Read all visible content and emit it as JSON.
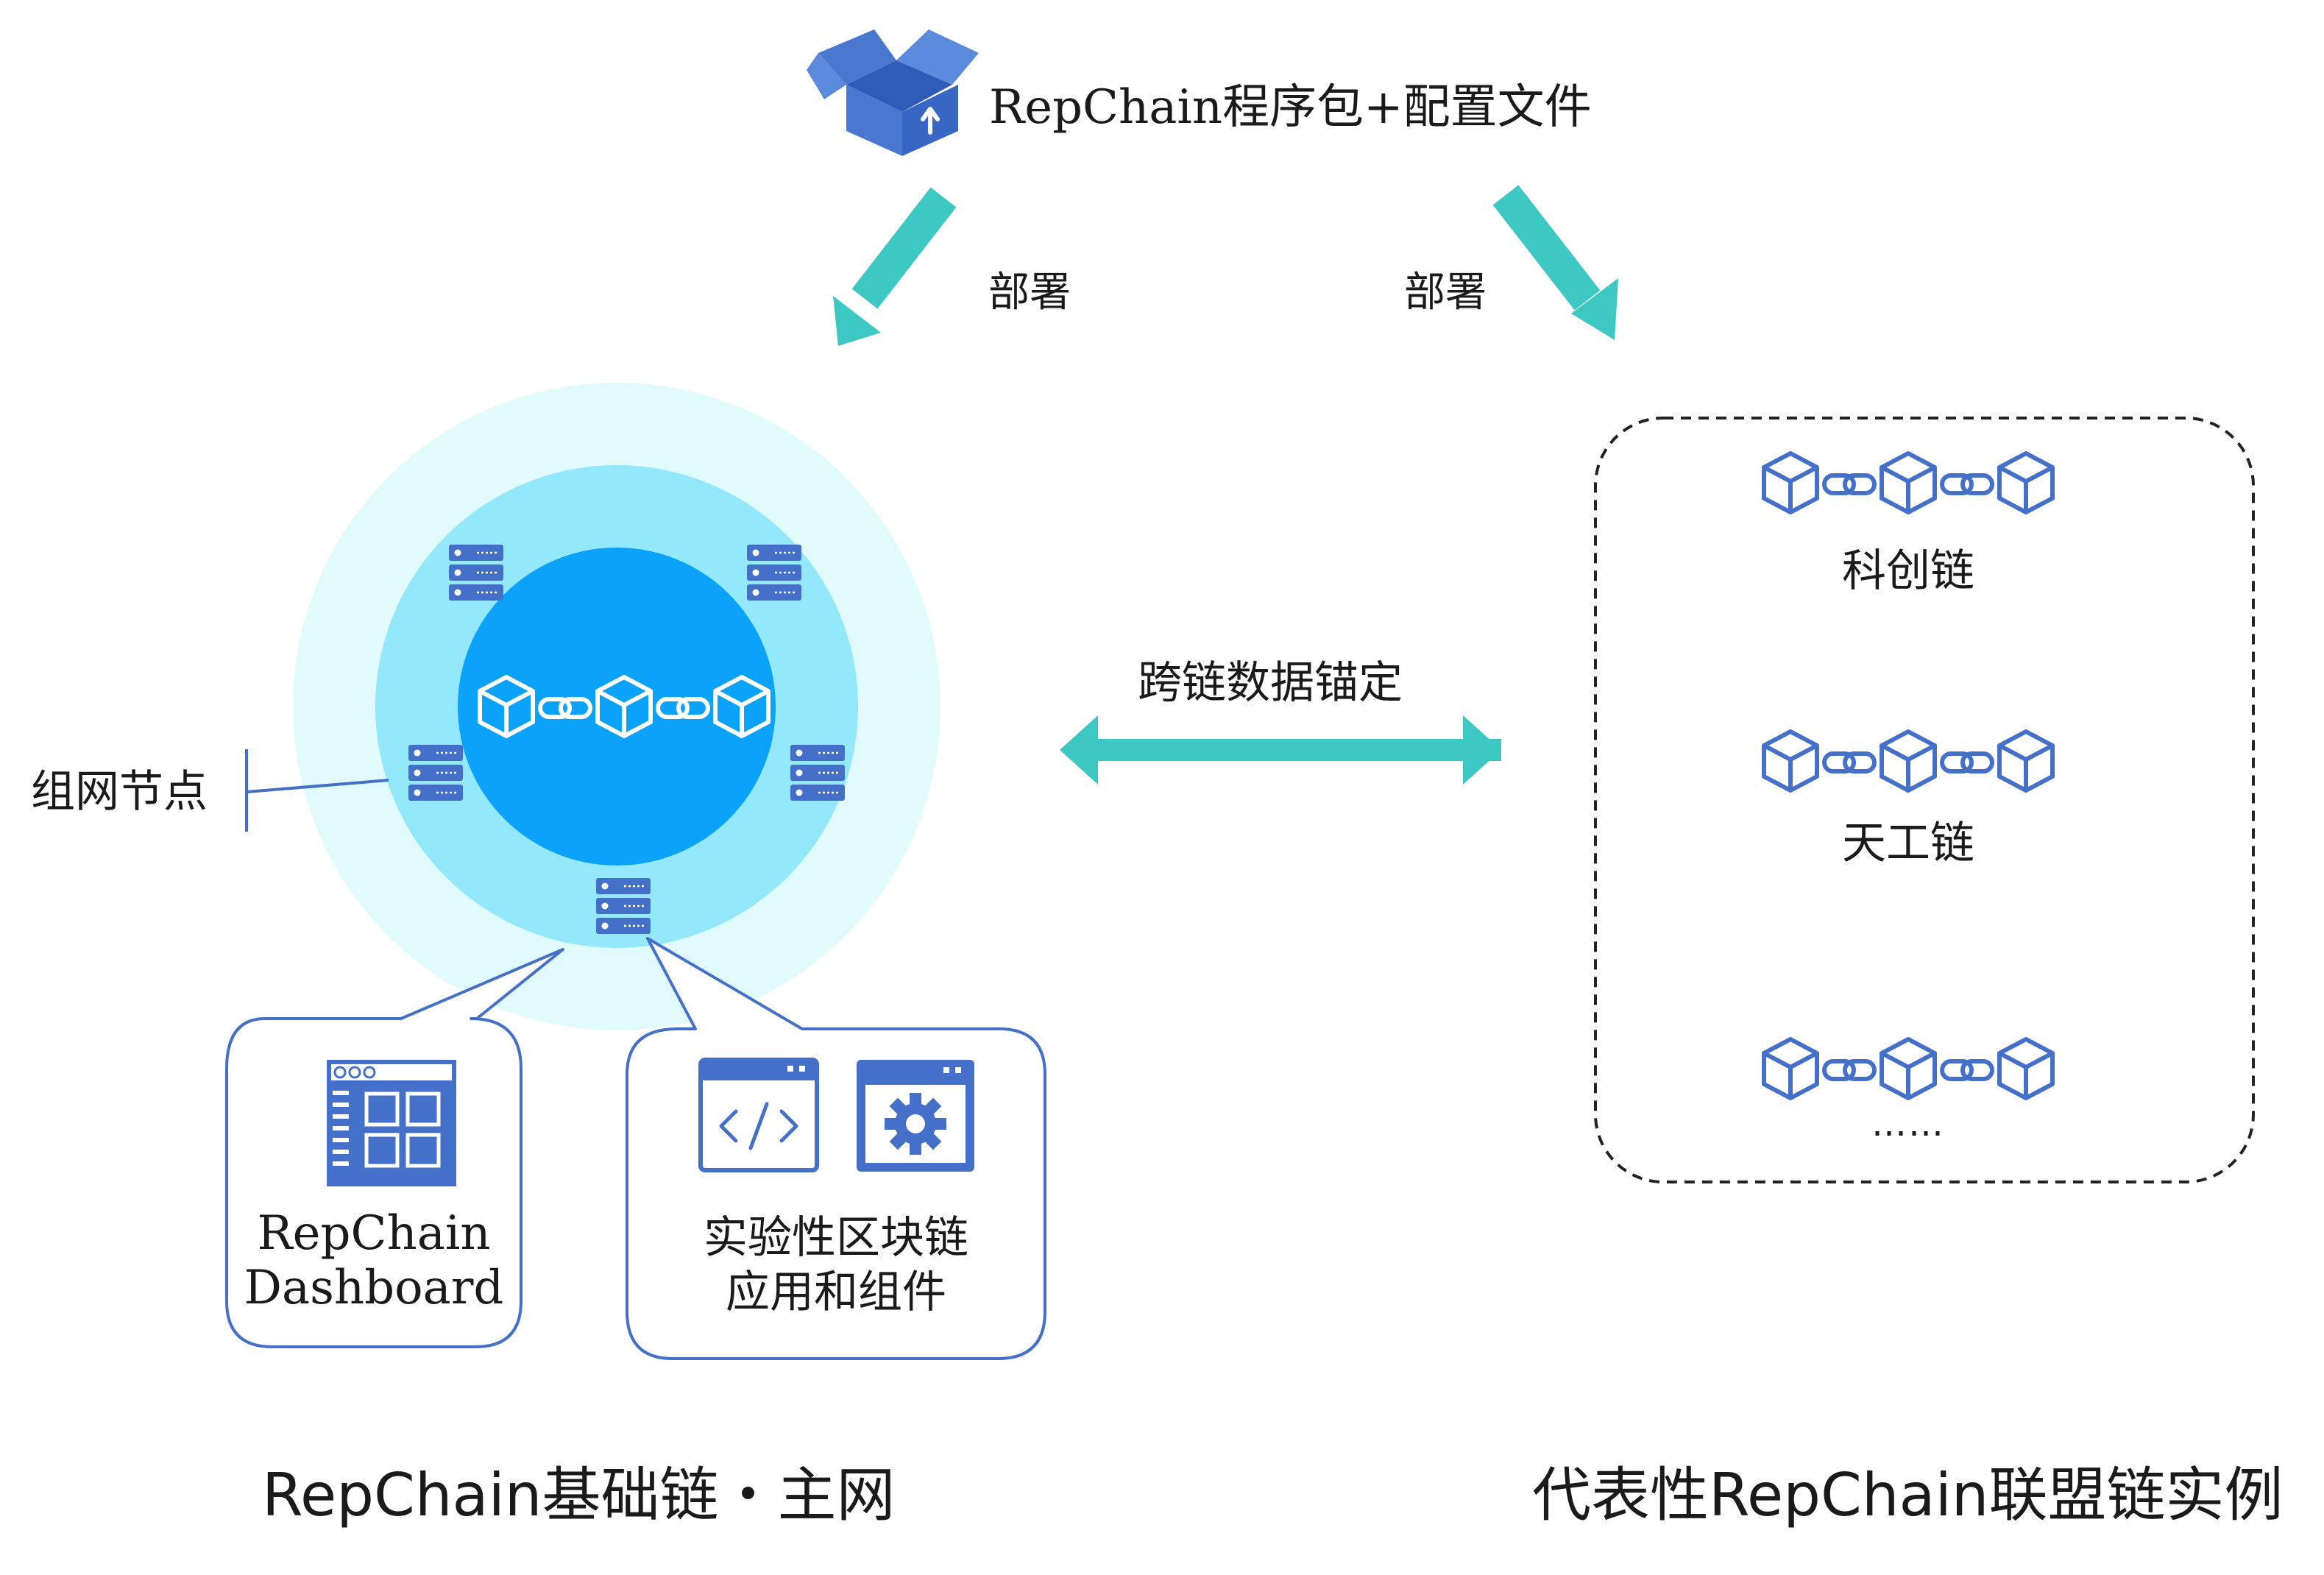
{
  "colors": {
    "teal": "#3ec8c4",
    "blue": "#4570c9",
    "outer_ring": "#e1fbfd",
    "middle_ring": "#93e8fb",
    "core": "#0aa2fb",
    "dashed_border": "#222222",
    "callout_border": "#4570c9"
  },
  "package": {
    "label": "RepChain程序包+配置文件",
    "icon": "package-box-icon"
  },
  "deploy": {
    "left_label": "部署",
    "right_label": "部署"
  },
  "network": {
    "node_label": "组网节点",
    "icon": "server-node-icon"
  },
  "cross_chain": {
    "label": "跨链数据锚定"
  },
  "callouts": {
    "dashboard": {
      "line1": "RepChain",
      "line2": "Dashboard",
      "icon": "dashboard-window-icon"
    },
    "apps": {
      "line1": "实验性区块链",
      "line2": "应用和组件",
      "icons": [
        "code-window-icon",
        "settings-window-icon"
      ]
    }
  },
  "consortium": {
    "chains": [
      {
        "label": "科创链"
      },
      {
        "label": "天工链"
      },
      {
        "label": "……"
      }
    ]
  },
  "captions": {
    "left": "RepChain基础链・主网",
    "right": "代表性RepChain联盟链实例"
  }
}
